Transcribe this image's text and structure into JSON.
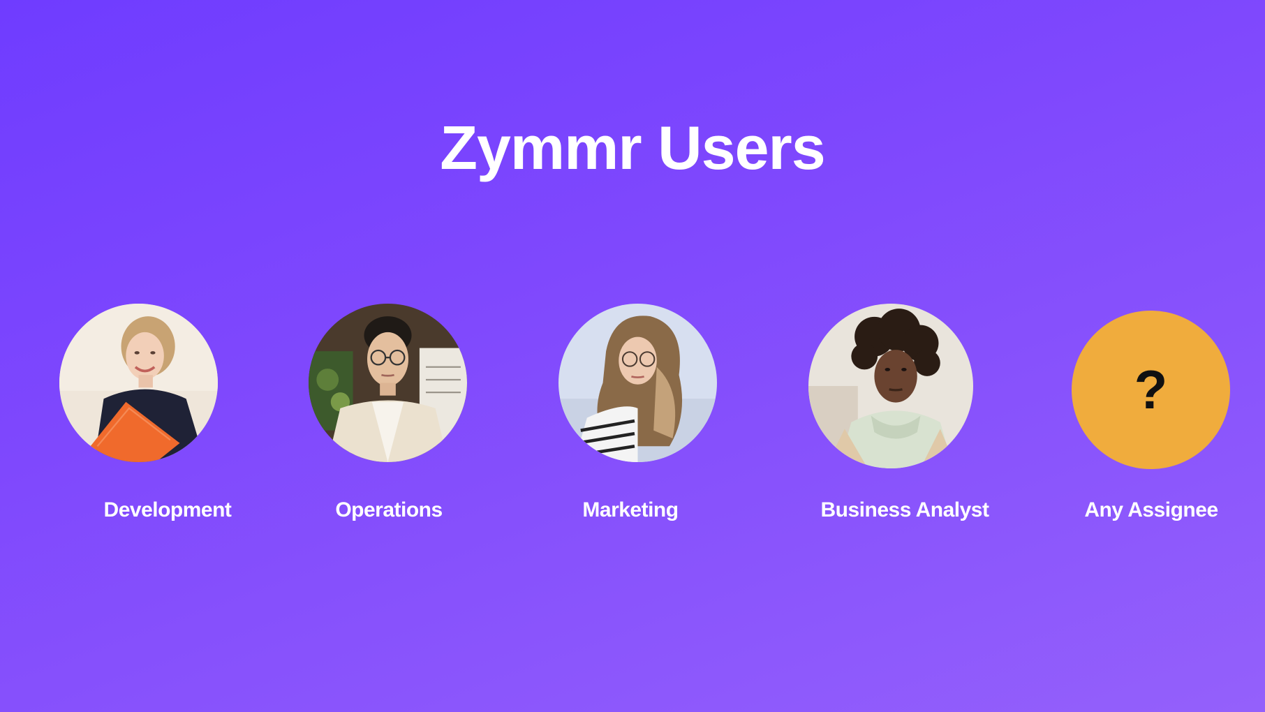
{
  "page": {
    "title": "Zymmr Users",
    "background_colors": [
      "#6f3cff",
      "#9460fb"
    ]
  },
  "users": [
    {
      "label": "Development",
      "avatar": "woman-with-orange-folder-photo"
    },
    {
      "label": "Operations",
      "avatar": "man-with-glasses-photo"
    },
    {
      "label": "Marketing",
      "avatar": "woman-with-glasses-photo"
    },
    {
      "label": "Business Analyst",
      "avatar": "man-with-curly-hair-photo"
    },
    {
      "label": "Any Assignee",
      "avatar": "question-mark-icon",
      "symbol": "?",
      "color": "#f0ac3d"
    }
  ]
}
